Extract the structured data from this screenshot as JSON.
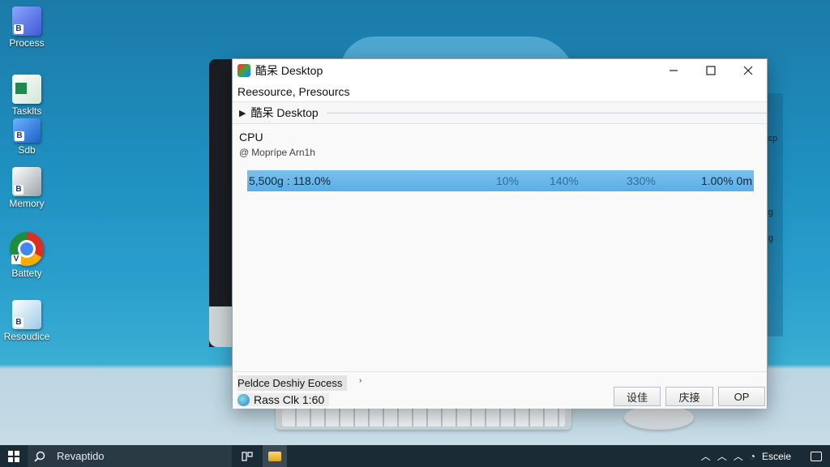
{
  "desktop": {
    "icons": [
      {
        "label": "Process",
        "icon": "process-icon",
        "badge": "B"
      },
      {
        "label": "Tasklts",
        "icon": "tasks-icon",
        "badge": ""
      },
      {
        "label": "Sdb",
        "icon": "sdb-icon",
        "badge": "B"
      },
      {
        "label": "Memory",
        "icon": "memory-icon",
        "badge": "B"
      },
      {
        "label": "Battety",
        "icon": "chrome-icon",
        "badge": "V"
      },
      {
        "label": "Resoudice",
        "icon": "resource-icon",
        "badge": "B"
      }
    ],
    "right_labels": [
      "ɪɛp",
      "ɪɡ",
      "ɪɡ"
    ]
  },
  "window": {
    "title": "酷呆 Desktop",
    "menu_line": "Reesource, Presourcs",
    "tree_label": "酷呆 Desktop",
    "section_title": "CPU",
    "section_sub": "Moprípe Arn1h",
    "cpu_bar": {
      "lead": "5,500g : 118.0%",
      "t1": "10%",
      "t2": "140%",
      "t3": "330%",
      "t4": "1.00% 0m",
      "fill_fraction": 1.0
    },
    "status_line1": "Peldce Deshiy Eocess",
    "status_line2": "Rass Clk 1:60",
    "buttons": [
      "设佳",
      "庆接",
      "OP"
    ]
  },
  "taskbar": {
    "search_text": "Revaptido",
    "tray_text": "Esceie"
  },
  "colors": {
    "accent": "#5aaee6",
    "taskbar": "#1b2b36"
  }
}
